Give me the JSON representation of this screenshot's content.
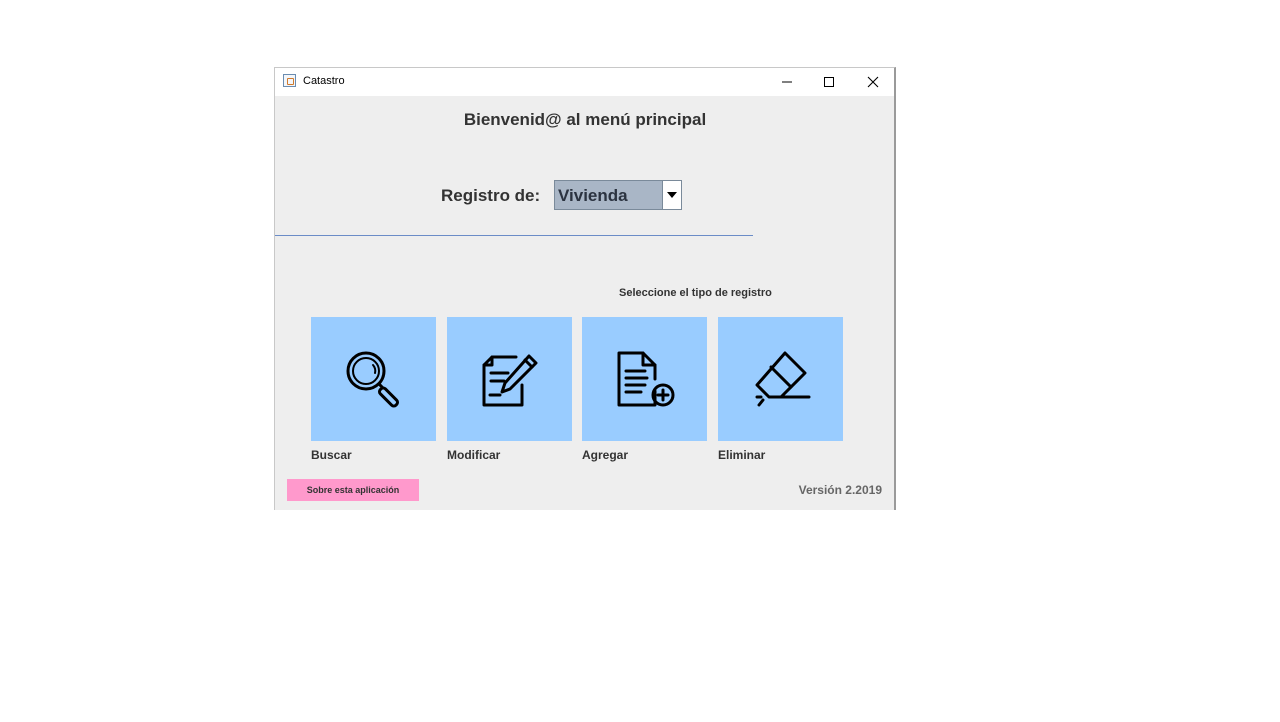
{
  "window": {
    "title": "Catastro",
    "controls": {
      "minimize": "minimize-icon",
      "maximize": "maximize-icon",
      "close": "close-icon"
    }
  },
  "main": {
    "welcome": "Bienvenid@ al menú principal",
    "registro_label": "Registro de:",
    "registro_value": "Vivienda",
    "hint": "Seleccione el tipo de registro"
  },
  "actions": [
    {
      "label": "Buscar",
      "icon": "search-icon"
    },
    {
      "label": "Modificar",
      "icon": "edit-document-icon"
    },
    {
      "label": "Agregar",
      "icon": "add-document-icon"
    },
    {
      "label": "Eliminar",
      "icon": "eraser-icon"
    }
  ],
  "footer": {
    "about": "Sobre esta aplicación",
    "version": "Versión 2.2019"
  },
  "colors": {
    "tile": "#99ccff",
    "about_button": "#ff99cc",
    "divider": "#6b8cc7",
    "background": "#eeeeee"
  }
}
